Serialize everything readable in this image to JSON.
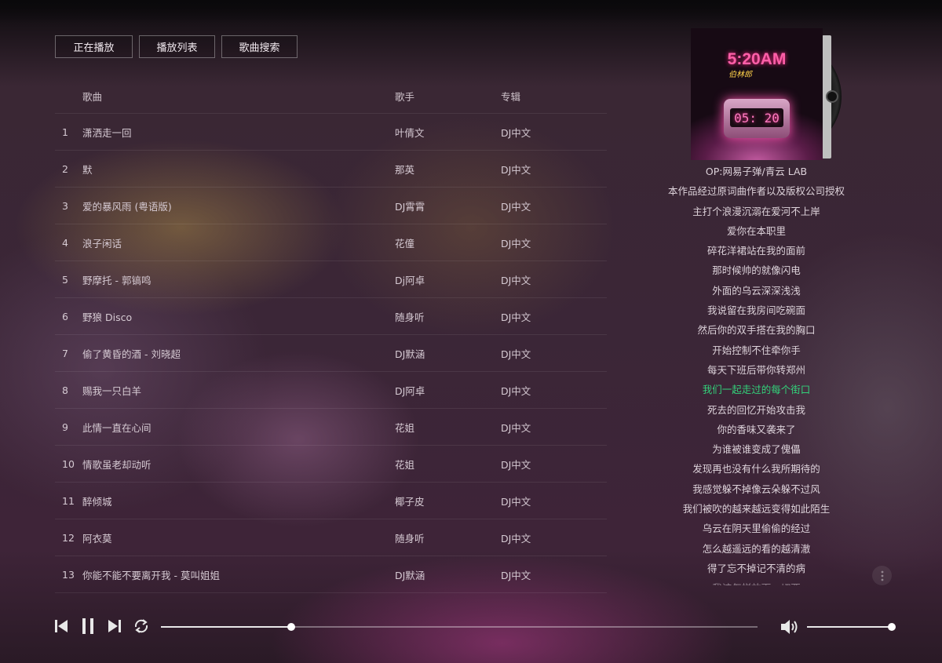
{
  "tabs": [
    "正在播放",
    "播放列表",
    "歌曲搜索"
  ],
  "columns": {
    "song": "歌曲",
    "artist": "歌手",
    "album": "专辑"
  },
  "songs": [
    {
      "num": "1",
      "title": "潇洒走一回",
      "artist": "叶倩文",
      "album": "DJ中文"
    },
    {
      "num": "2",
      "title": "默",
      "artist": "那英",
      "album": "DJ中文"
    },
    {
      "num": "3",
      "title": "爱的暴风雨 (粤语版)",
      "artist": "DJ霄霄",
      "album": "DJ中文"
    },
    {
      "num": "4",
      "title": "浪子闲话",
      "artist": "花僮",
      "album": "DJ中文"
    },
    {
      "num": "5",
      "title": "野摩托 - 郭镐鸣",
      "artist": "Dj阿卓",
      "album": "DJ中文"
    },
    {
      "num": "6",
      "title": "野狼 Disco",
      "artist": "随身听",
      "album": "DJ中文"
    },
    {
      "num": "7",
      "title": "偷了黄昏的酒 - 刘晓超",
      "artist": "DJ默涵",
      "album": "DJ中文"
    },
    {
      "num": "8",
      "title": "赐我一只白羊",
      "artist": "DJ阿卓",
      "album": "DJ中文"
    },
    {
      "num": "9",
      "title": "此情一直在心间",
      "artist": "花姐",
      "album": "DJ中文"
    },
    {
      "num": "10",
      "title": "情歌虽老却动听",
      "artist": "花姐",
      "album": "DJ中文"
    },
    {
      "num": "11",
      "title": "醉倾城",
      "artist": "椰子皮",
      "album": "DJ中文"
    },
    {
      "num": "12",
      "title": "阿衣莫",
      "artist": "随身听",
      "album": "DJ中文"
    },
    {
      "num": "13",
      "title": "你能不能不要离开我 - 莫叫姐姐",
      "artist": "DJ默涵",
      "album": "DJ中文"
    }
  ],
  "cover": {
    "title": "5:20AM",
    "subtitle": "伯林郎",
    "clock": "05: 20"
  },
  "lyrics": [
    "OP:网易子弹/青云 LAB",
    "本作品经过原词曲作者以及版权公司授权",
    "主打个浪漫沉溺在爱河不上岸",
    "爱你在本职里",
    "碎花洋裙站在我的面前",
    "那时候帅的就像闪电",
    "外面的乌云深深浅浅",
    "我说留在我房间吃碗面",
    "然后你的双手搭在我的胸口",
    "开始控制不住牵你手",
    "每天下班后带你转郑州",
    "我们一起走过的每个街口",
    "死去的回忆开始攻击我",
    "你的香味又袭来了",
    "为谁被谁变成了傀儡",
    "发现再也没有什么我所期待的",
    "我感觉躲不掉像云朵躲不过风",
    "我们被吹的越来越远变得如此陌生",
    "乌云在阴天里偷偷的经过",
    "怎么越遥远的看的越清澈",
    "得了忘不掉记不清的病",
    "我该怎样放下一切西"
  ],
  "active_lyric_index": 11,
  "player": {
    "progress": 0.218,
    "volume": 1.0
  }
}
